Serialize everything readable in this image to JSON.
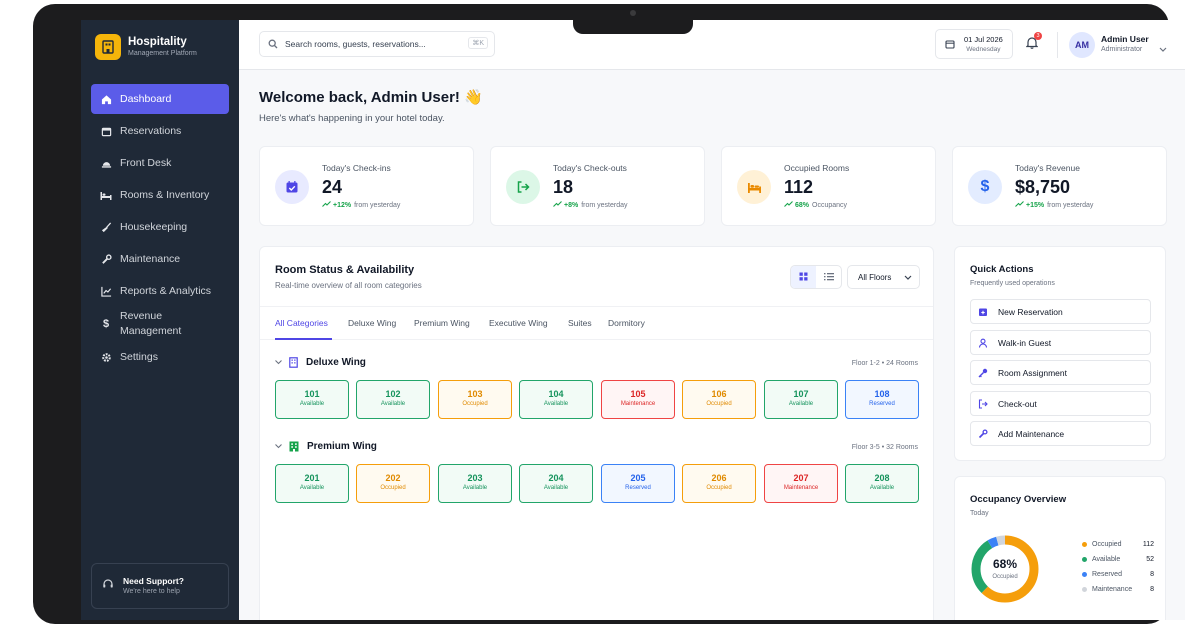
{
  "brand": {
    "title": "Hospitality",
    "subtitle": "Management Platform"
  },
  "sidebar": {
    "items": [
      {
        "label": "Dashboard",
        "icon": "home-icon",
        "active": true
      },
      {
        "label": "Reservations",
        "icon": "calendar-icon"
      },
      {
        "label": "Front Desk",
        "icon": "bell-desk-icon"
      },
      {
        "label": "Rooms & Inventory",
        "icon": "bed-icon"
      },
      {
        "label": "Housekeeping",
        "icon": "broom-icon"
      },
      {
        "label": "Maintenance",
        "icon": "wrench-icon"
      },
      {
        "label": "Reports & Analytics",
        "icon": "chart-icon"
      },
      {
        "label": "Revenue Management",
        "icon": "dollar-icon"
      },
      {
        "label": "Settings",
        "icon": "gear-icon"
      }
    ],
    "support": {
      "title": "Need Support?",
      "subtitle": "We're here to help"
    }
  },
  "topbar": {
    "search_placeholder": "Search rooms, guests, reservations...",
    "search_shortcut": "⌘K",
    "date": "01 Jul 2026",
    "weekday": "Wednesday",
    "notification_count": "3",
    "user": {
      "initials": "AM",
      "name": "Admin User",
      "role": "Administrator"
    }
  },
  "welcome": {
    "title": "Welcome back, Admin User! 👋",
    "subtitle": "Here's what's happening in your hotel today."
  },
  "stats": [
    {
      "label": "Today's Check-ins",
      "value": "24",
      "trend": "+12%",
      "trend_note": "from yesterday",
      "icon": "calendar-check-icon",
      "color": "#4f46e5",
      "bg": "#e8eaff"
    },
    {
      "label": "Today's Check-outs",
      "value": "18",
      "trend": "+8%",
      "trend_note": "from yesterday",
      "icon": "logout-icon",
      "color": "#16a34a",
      "bg": "#dcf7e7"
    },
    {
      "label": "Occupied Rooms",
      "value": "112",
      "trend": "68%",
      "trend_note": "Occupancy",
      "icon": "bed-icon",
      "color": "#ea8a00",
      "bg": "#fff1d6"
    },
    {
      "label": "Today's Revenue",
      "value": "$8,750",
      "trend": "+15%",
      "trend_note": "from yesterday",
      "icon": "dollar-icon",
      "color": "#2563eb",
      "bg": "#e3ecff"
    }
  ],
  "room_panel": {
    "title": "Room Status & Availability",
    "subtitle": "Real-time overview of all room categories",
    "floor_filter": "All Floors",
    "tabs": [
      "All Categories",
      "Deluxe Wing",
      "Premium Wing",
      "Executive Wing",
      "Suites",
      "Dormitory"
    ],
    "groups": [
      {
        "name": "Deluxe Wing",
        "meta": "Floor 1-2 • 24 Rooms",
        "rooms": [
          {
            "number": "101",
            "status": "Available"
          },
          {
            "number": "102",
            "status": "Available"
          },
          {
            "number": "103",
            "status": "Occupied"
          },
          {
            "number": "104",
            "status": "Available"
          },
          {
            "number": "105",
            "status": "Maintenance"
          },
          {
            "number": "106",
            "status": "Occupied"
          },
          {
            "number": "107",
            "status": "Available"
          },
          {
            "number": "108",
            "status": "Reserved"
          }
        ]
      },
      {
        "name": "Premium Wing",
        "meta": "Floor 3-5 • 32 Rooms",
        "rooms": [
          {
            "number": "201",
            "status": "Available"
          },
          {
            "number": "202",
            "status": "Occupied"
          },
          {
            "number": "203",
            "status": "Available"
          },
          {
            "number": "204",
            "status": "Available"
          },
          {
            "number": "205",
            "status": "Reserved"
          },
          {
            "number": "206",
            "status": "Occupied"
          },
          {
            "number": "207",
            "status": "Maintenance"
          },
          {
            "number": "208",
            "status": "Available"
          }
        ]
      }
    ]
  },
  "quick_actions": {
    "title": "Quick Actions",
    "subtitle": "Frequently used operations",
    "items": [
      {
        "label": "New Reservation",
        "icon": "calendar-plus-icon"
      },
      {
        "label": "Walk-in Guest",
        "icon": "user-icon"
      },
      {
        "label": "Room Assignment",
        "icon": "key-icon"
      },
      {
        "label": "Check-out",
        "icon": "logout-icon"
      },
      {
        "label": "Add Maintenance",
        "icon": "wrench-icon"
      }
    ]
  },
  "occupancy": {
    "title": "Occupancy Overview",
    "subtitle": "Today",
    "percent_label": "68%",
    "center_label": "Occupied",
    "segments": [
      {
        "label": "Occupied",
        "value": 112,
        "color": "#f59e0b"
      },
      {
        "label": "Available",
        "value": 52,
        "color": "#22a56a"
      },
      {
        "label": "Reserved",
        "value": 8,
        "color": "#3b82f6"
      },
      {
        "label": "Maintenance",
        "value": 8,
        "color": "#d1d5db"
      }
    ]
  },
  "colors": {
    "accent": "#5b5ce9",
    "sidebar": "#1f2937"
  }
}
